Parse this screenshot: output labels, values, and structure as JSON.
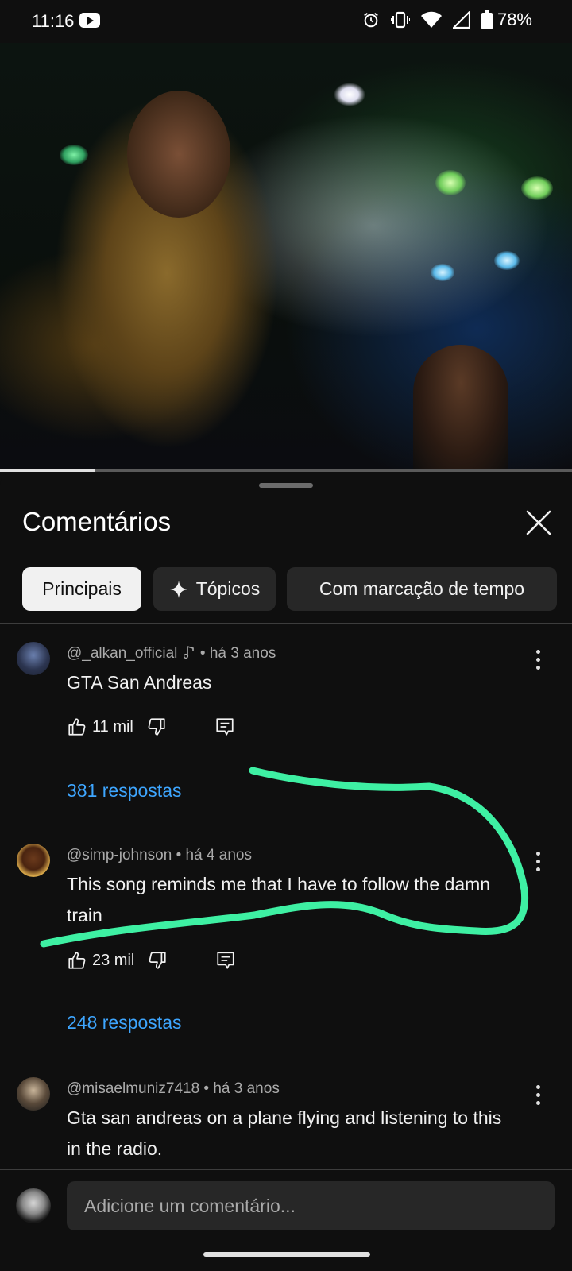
{
  "status_bar": {
    "time": "11:16",
    "battery": "78%"
  },
  "video": {
    "progress": 0.165
  },
  "sheet": {
    "title": "Comentários",
    "chips": [
      {
        "label": "Principais",
        "active": true
      },
      {
        "label": "Tópicos",
        "icon": "sparkle-icon",
        "active": false
      },
      {
        "label": "Com marcação de tempo",
        "active": false
      }
    ]
  },
  "comments": [
    {
      "author": "@_alkan_official",
      "author_badge": "music-note-icon",
      "time": "há 3 anos",
      "text": "GTA San Andreas",
      "likes": "11 mil",
      "replies": "381 respostas"
    },
    {
      "author": "@simp-johnson",
      "time": "há 4 anos",
      "text": "This song reminds me that I have to follow the damn train",
      "likes": "23 mil",
      "replies": "248 respostas"
    },
    {
      "author": "@misaelmuniz7418",
      "time": "há 3 anos",
      "text": "Gta san andreas on a plane flying and listening to this in the radio."
    }
  ],
  "composer": {
    "placeholder": "Adicione um comentário..."
  },
  "colors": {
    "link": "#3ea6ff",
    "annotation_stroke": "#3ef0a3",
    "background": "#0f0f0f",
    "chip": "#272727"
  }
}
